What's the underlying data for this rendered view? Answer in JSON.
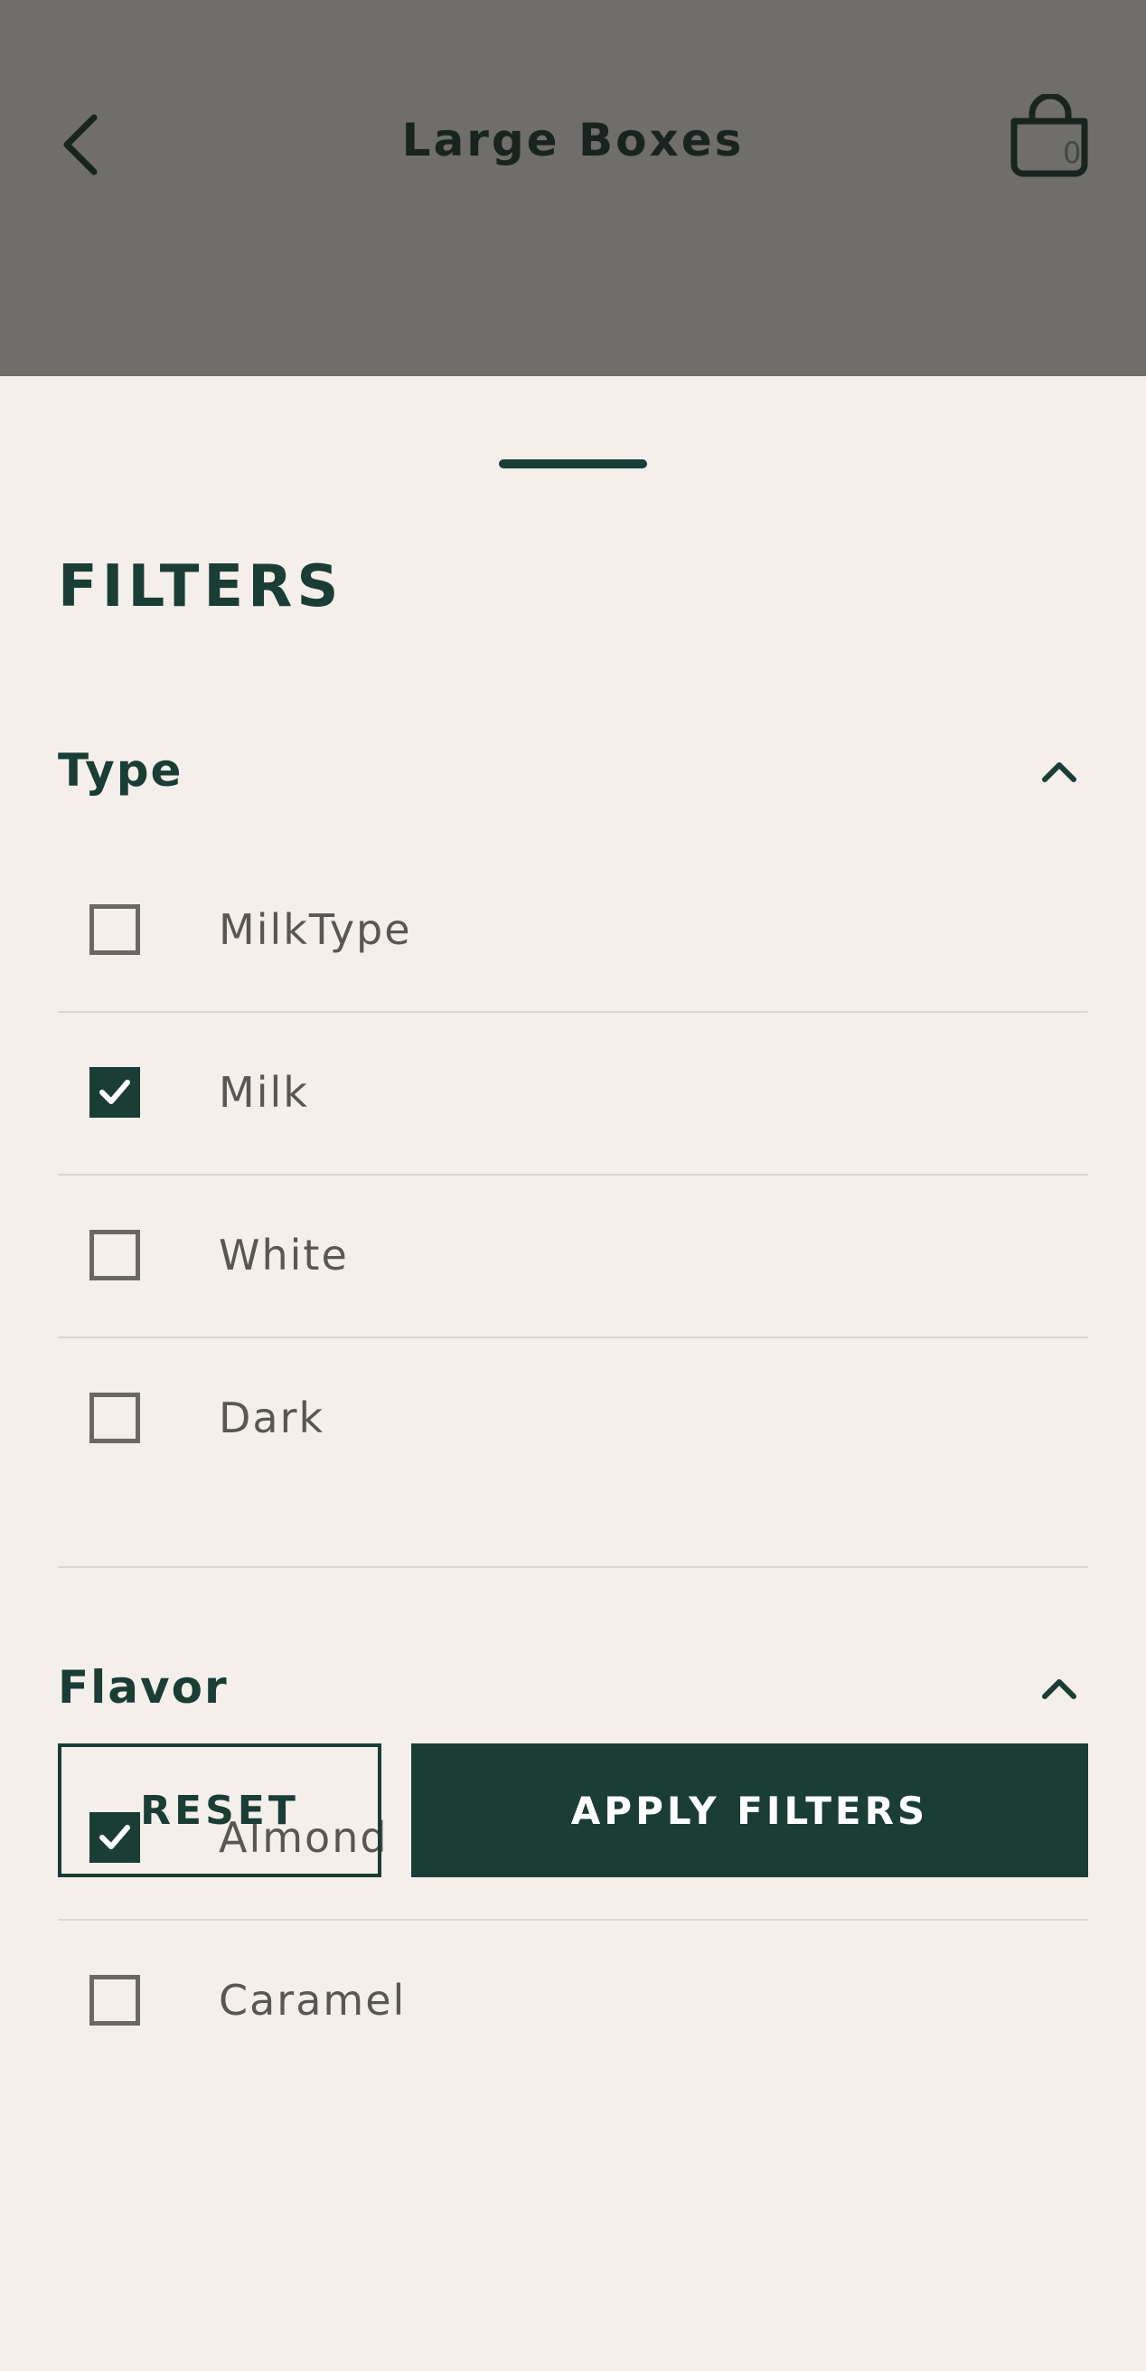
{
  "header": {
    "title": "Large Boxes",
    "back_icon": "chevron-left-icon",
    "cart_icon": "shopping-bag-icon",
    "cart_count": "0"
  },
  "sheet": {
    "title": "FILTERS",
    "sections": [
      {
        "title": "Type",
        "expanded": true,
        "options": [
          {
            "label": "MilkType",
            "checked": false
          },
          {
            "label": "Milk",
            "checked": true
          },
          {
            "label": "White",
            "checked": false
          },
          {
            "label": "Dark",
            "checked": false
          }
        ]
      },
      {
        "title": "Flavor",
        "expanded": true,
        "options": [
          {
            "label": "Almond",
            "checked": true
          },
          {
            "label": "Caramel",
            "checked": false
          }
        ]
      }
    ]
  },
  "actions": {
    "reset_label": "RESET",
    "apply_label": "APPLY FILTERS"
  },
  "colors": {
    "accent": "#1a3d35",
    "overlay": "#706e6a",
    "background": "#f4efea"
  }
}
